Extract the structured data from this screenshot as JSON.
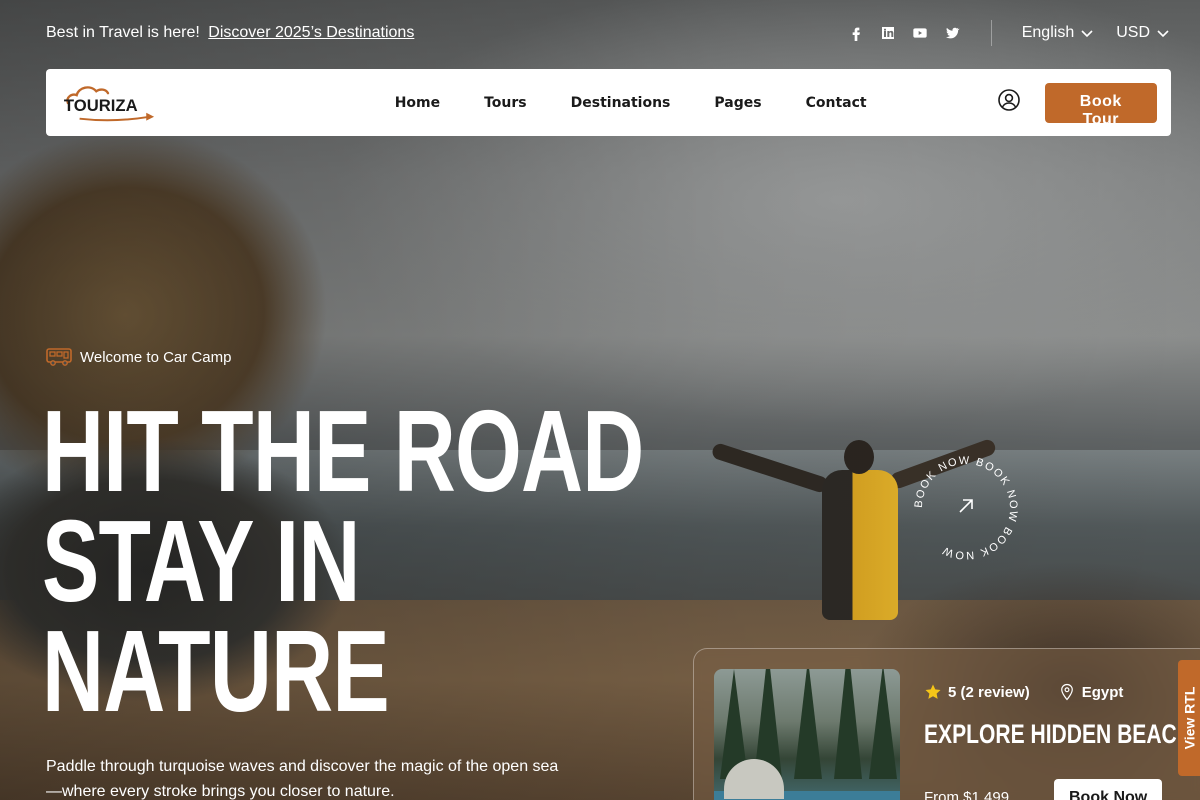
{
  "topbar": {
    "announce_text": "Best in Travel is here!",
    "announce_link": "Discover 2025’s Destinations",
    "socials": [
      "facebook-icon",
      "linkedin-icon",
      "youtube-icon",
      "twitter-icon"
    ],
    "language": "English",
    "currency": "USD"
  },
  "nav": {
    "logo_text": "TOURIZA",
    "items": [
      "Home",
      "Tours",
      "Destinations",
      "Pages",
      "Contact"
    ],
    "cta": "Book Tour"
  },
  "hero": {
    "eyebrow": "Welcome to Car Camp",
    "headline": [
      "HIT THE ROAD",
      "STAY IN",
      "NATURE"
    ],
    "description": "Paddle through turquoise waves and discover the magic of the open sea —where every stroke brings you closer to nature.",
    "circle_text": "BOOK NOW BOOK NOW BOOK NOW"
  },
  "tour_card": {
    "rating": "5 (2 review)",
    "location": "Egypt",
    "title": "EXPLORE HIDDEN BEACHES",
    "price": "From $1,499",
    "button": "Book Now"
  },
  "side_tab": {
    "label": "View RTL"
  },
  "colors": {
    "accent": "#c0692a",
    "star": "#f5c518"
  }
}
